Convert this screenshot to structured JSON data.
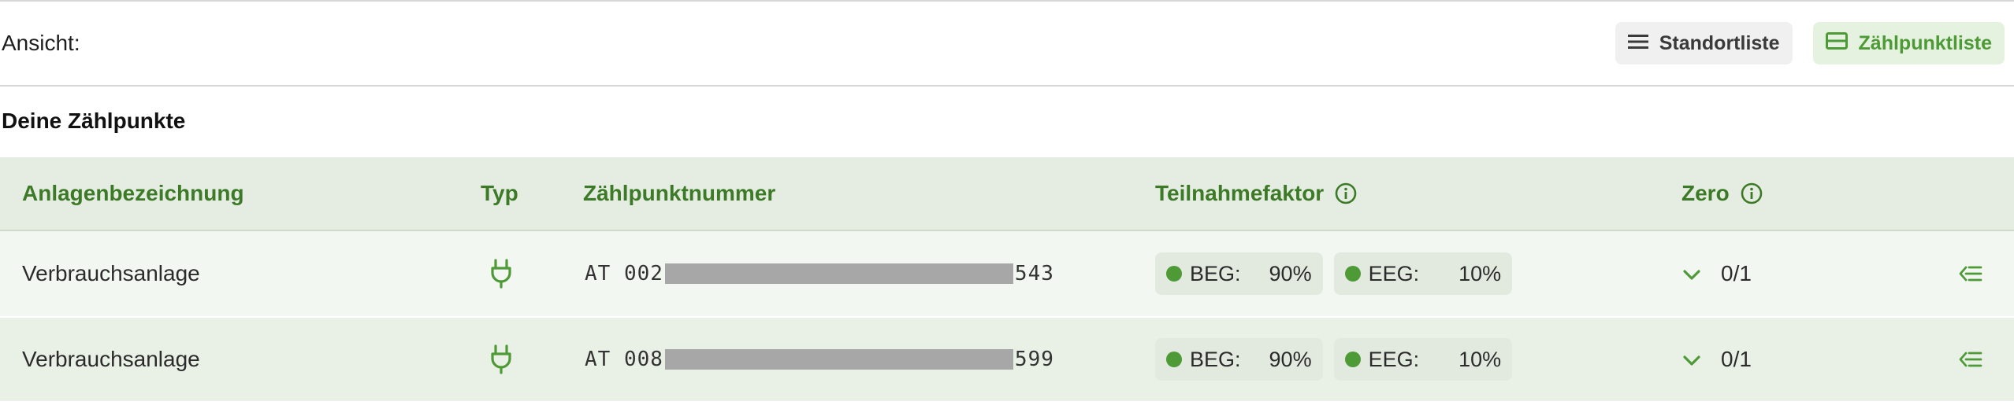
{
  "view": {
    "label": "Ansicht:",
    "options": [
      {
        "label": "Standortliste",
        "icon": "list-icon",
        "active": false
      },
      {
        "label": "Zählpunktliste",
        "icon": "table-icon",
        "active": true
      }
    ]
  },
  "section_title": "Deine Zählpunkte",
  "table": {
    "headers": {
      "name": "Anlagenbezeichnung",
      "type": "Typ",
      "number": "Zählpunktnummer",
      "factor": "Teilnahmefaktor",
      "zero": "Zero"
    },
    "rows": [
      {
        "name": "Verbrauchsanlage",
        "type_icon": "plug-icon",
        "number_prefix": "AT 002",
        "number_suffix": "543",
        "beg_label": "BEG:",
        "beg_value": "90%",
        "eeg_label": "EEG:",
        "eeg_value": "10%",
        "zero": "0/1"
      },
      {
        "name": "Verbrauchsanlage",
        "type_icon": "plug-icon",
        "number_prefix": "AT 008",
        "number_suffix": "599",
        "beg_label": "BEG:",
        "beg_value": "90%",
        "eeg_label": "EEG:",
        "eeg_value": "10%",
        "zero": "0/1"
      }
    ]
  },
  "colors": {
    "accent": "#4e9a36",
    "header_text": "#3d7a27",
    "header_bg": "#e5ede3",
    "row_bg_1": "#f3f7f1",
    "row_bg_2": "#e9f1e6"
  }
}
